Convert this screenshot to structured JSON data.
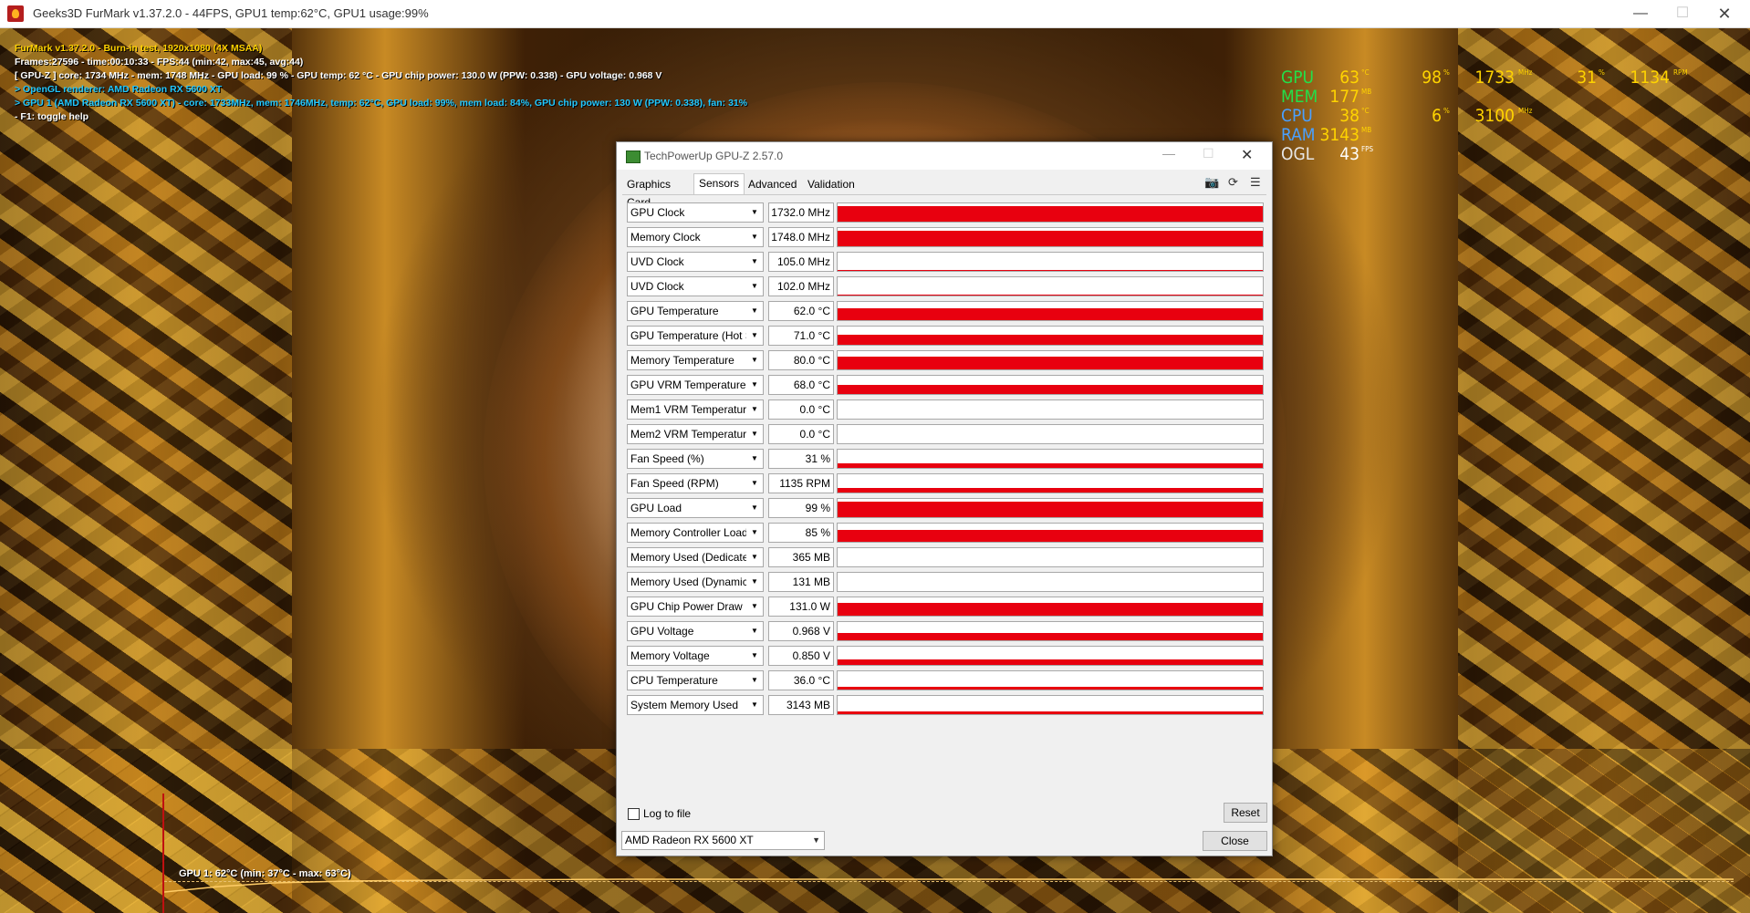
{
  "furmark": {
    "window_title": "Geeks3D FurMark v1.37.2.0 - 44FPS, GPU1 temp:62°C, GPU1 usage:99%",
    "info_lines": [
      "FurMark v1.37.2.0 - Burn-in test, 1920x1080 (4X MSAA)",
      "Frames:27596 - time:00:10:33 - FPS:44 (min:42, max:45, avg:44)",
      "[ GPU-Z ] core: 1734 MHz - mem: 1748 MHz - GPU load: 99 % - GPU temp: 62 °C - GPU chip power: 130.0 W (PPW: 0.338) - GPU voltage: 0.968 V",
      "> OpenGL renderer: AMD Radeon RX 5600 XT",
      "> GPU 1 (AMD Radeon RX 5600 XT) - core: 1733MHz, mem: 1746MHz, temp: 62°C, GPU load: 99%, mem load: 84%, GPU chip power: 130 W (PPW: 0.338), fan: 31%",
      "- F1: toggle help"
    ],
    "graph_label": "GPU 1: 62°C (min: 37°C - max: 63°C)"
  },
  "osd": {
    "gpu": {
      "label": "GPU",
      "temp": "63",
      "temp_unit": "°C",
      "usage": "98",
      "usage_unit": "%",
      "clock": "1733",
      "clock_unit": "MHz",
      "fan": "31",
      "fan_unit": "%",
      "rpm": "1134",
      "rpm_unit": "RPM"
    },
    "mem": {
      "label": "MEM",
      "value": "177",
      "unit": "MB"
    },
    "cpu": {
      "label": "CPU",
      "temp": "38",
      "temp_unit": "°C",
      "usage": "6",
      "usage_unit": "%",
      "clock": "3100",
      "clock_unit": "MHz"
    },
    "ram": {
      "label": "RAM",
      "value": "3143",
      "unit": "MB"
    },
    "ogl": {
      "label": "OGL",
      "value": "43",
      "unit": "FPS"
    }
  },
  "gpuz": {
    "title": "TechPowerUp GPU-Z 2.57.0",
    "tabs": [
      "Graphics Card",
      "Sensors",
      "Advanced",
      "Validation"
    ],
    "active_tab": "Sensors",
    "sensors": [
      {
        "name": "GPU Clock",
        "value": "1732.0 MHz",
        "level": 0.95
      },
      {
        "name": "Memory Clock",
        "value": "1748.0 MHz",
        "level": 0.95
      },
      {
        "name": "UVD Clock",
        "value": "105.0 MHz",
        "level": 0.06
      },
      {
        "name": "UVD Clock",
        "value": "102.0 MHz",
        "level": 0.06
      },
      {
        "name": "GPU Temperature",
        "value": "62.0 °C",
        "level": 0.7
      },
      {
        "name": "GPU Temperature (Hot Spot)",
        "value": "71.0 °C",
        "level": 0.6
      },
      {
        "name": "Memory Temperature",
        "value": "80.0 °C",
        "level": 0.75
      },
      {
        "name": "GPU VRM Temperature",
        "value": "68.0 °C",
        "level": 0.55
      },
      {
        "name": "Mem1 VRM Temperature",
        "value": "0.0 °C",
        "level": 0
      },
      {
        "name": "Mem2 VRM Temperature",
        "value": "0.0 °C",
        "level": 0
      },
      {
        "name": "Fan Speed (%)",
        "value": "31 %",
        "level": 0.25
      },
      {
        "name": "Fan Speed (RPM)",
        "value": "1135 RPM",
        "level": 0.3
      },
      {
        "name": "GPU Load",
        "value": "99 %",
        "level": 0.95
      },
      {
        "name": "Memory Controller Load",
        "value": "85 %",
        "level": 0.7
      },
      {
        "name": "Memory Used (Dedicated)",
        "value": "365 MB",
        "level": 0
      },
      {
        "name": "Memory Used (Dynamic)",
        "value": "131 MB",
        "level": 0
      },
      {
        "name": "GPU Chip Power Draw",
        "value": "131.0 W",
        "level": 0.8
      },
      {
        "name": "GPU Voltage",
        "value": "0.968 V",
        "level": 0.45
      },
      {
        "name": "Memory Voltage",
        "value": "0.850 V",
        "level": 0.35
      },
      {
        "name": "CPU Temperature",
        "value": "36.0 °C",
        "level": 0.15
      },
      {
        "name": "System Memory Used",
        "value": "3143 MB",
        "level": 0.15
      }
    ],
    "log_to_file": "Log to file",
    "log_checked": false,
    "reset_label": "Reset",
    "device": "AMD Radeon RX 5600 XT",
    "close_label": "Close"
  }
}
